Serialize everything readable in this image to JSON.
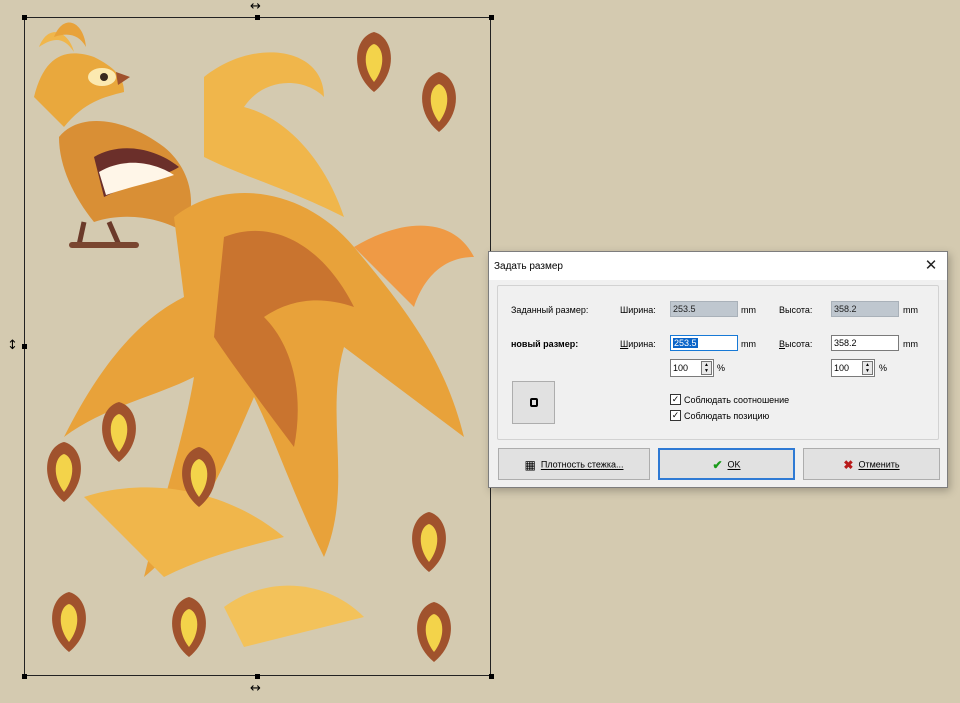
{
  "dialog": {
    "title": "Задать размер",
    "close_glyph": "✕",
    "given_size_label": "Заданный размер:",
    "new_size_label": "новый размер:",
    "width_label": "Ширина:",
    "height_label": "Высота:",
    "unit_mm": "mm",
    "unit_percent": "%",
    "given_width": "253.5",
    "given_height": "358.2",
    "new_width": "253.5",
    "new_height": "358.2",
    "width_percent": "100",
    "height_percent": "100",
    "keep_ratio_label": "Соблюдать соотношение",
    "keep_ratio_checked": true,
    "keep_position_label": "Соблюдать позицию",
    "keep_position_checked": true,
    "density_button": "Плотность стежка...",
    "ok_button": "OK",
    "cancel_button": "Отменить",
    "check_glyph": "✓",
    "icons": {
      "density": "calculator-icon",
      "ok": "checkmark-icon",
      "cancel": "x-icon",
      "preview": "outline-square-icon"
    },
    "colors": {
      "ok_icon": "#1a9b1a",
      "cancel_icon": "#b81a1a",
      "selection": "#0a64c8",
      "default_button_border": "#2f7ad4"
    }
  },
  "canvas": {
    "background": "#d4cab0",
    "design_colors": [
      "#e8a23a",
      "#f0c060",
      "#a0522d",
      "#f3d34a",
      "#6b2f2a"
    ]
  }
}
